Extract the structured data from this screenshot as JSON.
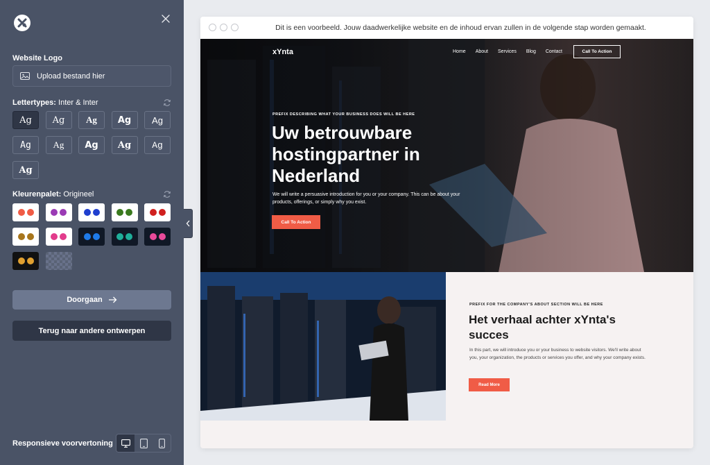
{
  "sidebar": {
    "website_logo_label": "Website Logo",
    "upload_label": "Upload bestand hier",
    "fonts_label": "Lettertypes:",
    "fonts_value": "Inter & Inter",
    "font_sample": "Ag",
    "palette_label": "Kleurenpalet:",
    "palette_value": "Origineel",
    "palettes": [
      {
        "bg": "#ffffff",
        "c1": "#f05c46",
        "c2": "#f05c46"
      },
      {
        "bg": "#ffffff",
        "c1": "#9b3bb5",
        "c2": "#9b3bb5"
      },
      {
        "bg": "#ffffff",
        "c1": "#1f3fcf",
        "c2": "#1f3fcf"
      },
      {
        "bg": "#ffffff",
        "c1": "#3a7a1e",
        "c2": "#3a7a1e"
      },
      {
        "bg": "#ffffff",
        "c1": "#d0201f",
        "c2": "#d0201f"
      },
      {
        "bg": "#ffffff",
        "c1": "#a8761d",
        "c2": "#a8761d"
      },
      {
        "bg": "#ffffff",
        "c1": "#e23c8c",
        "c2": "#e23c8c"
      },
      {
        "bg": "#101826",
        "c1": "#1f7ae8",
        "c2": "#1f7ae8"
      },
      {
        "bg": "#101826",
        "c1": "#1fae9a",
        "c2": "#1fae9a"
      },
      {
        "bg": "#101826",
        "c1": "#e84a9a",
        "c2": "#e84a9a"
      },
      {
        "bg": "#111111",
        "c1": "#e0a030",
        "c2": "#e0a030"
      }
    ],
    "continue_label": "Doorgaan",
    "back_label": "Terug naar andere ontwerpen",
    "responsive_label": "Responsieve voorvertoning"
  },
  "preview": {
    "notice": "Dit is een voorbeeld. Jouw daadwerkelijke website en de inhoud ervan zullen in de volgende stap worden gemaakt.",
    "brand": "xYnta",
    "nav": [
      "Home",
      "About",
      "Services",
      "Blog",
      "Contact"
    ],
    "nav_cta": "Call To Action",
    "hero": {
      "prefix": "PREFIX DESCRIBING WHAT YOUR BUSINESS DOES WILL BE HERE",
      "title": "Uw betrouwbare hostingpartner in Nederland",
      "text": "We will write a persuasive introduction for you or your company. This can be about your products, offerings, or simply why you exist.",
      "cta": "Call To Action"
    },
    "about": {
      "prefix": "PREFIX FOR THE COMPANY'S ABOUT SECTION WILL BE HERE",
      "title": "Het verhaal achter xYnta's succes",
      "text": "In this part, we will introduce you or your business to website visitors. We'll write about you, your organization, the products or services you offer, and why your company exists.",
      "cta": "Read More"
    }
  },
  "colors": {
    "sidebar_bg": "#4a5366",
    "accent": "#f05c46",
    "dark_button": "#2f3646"
  }
}
